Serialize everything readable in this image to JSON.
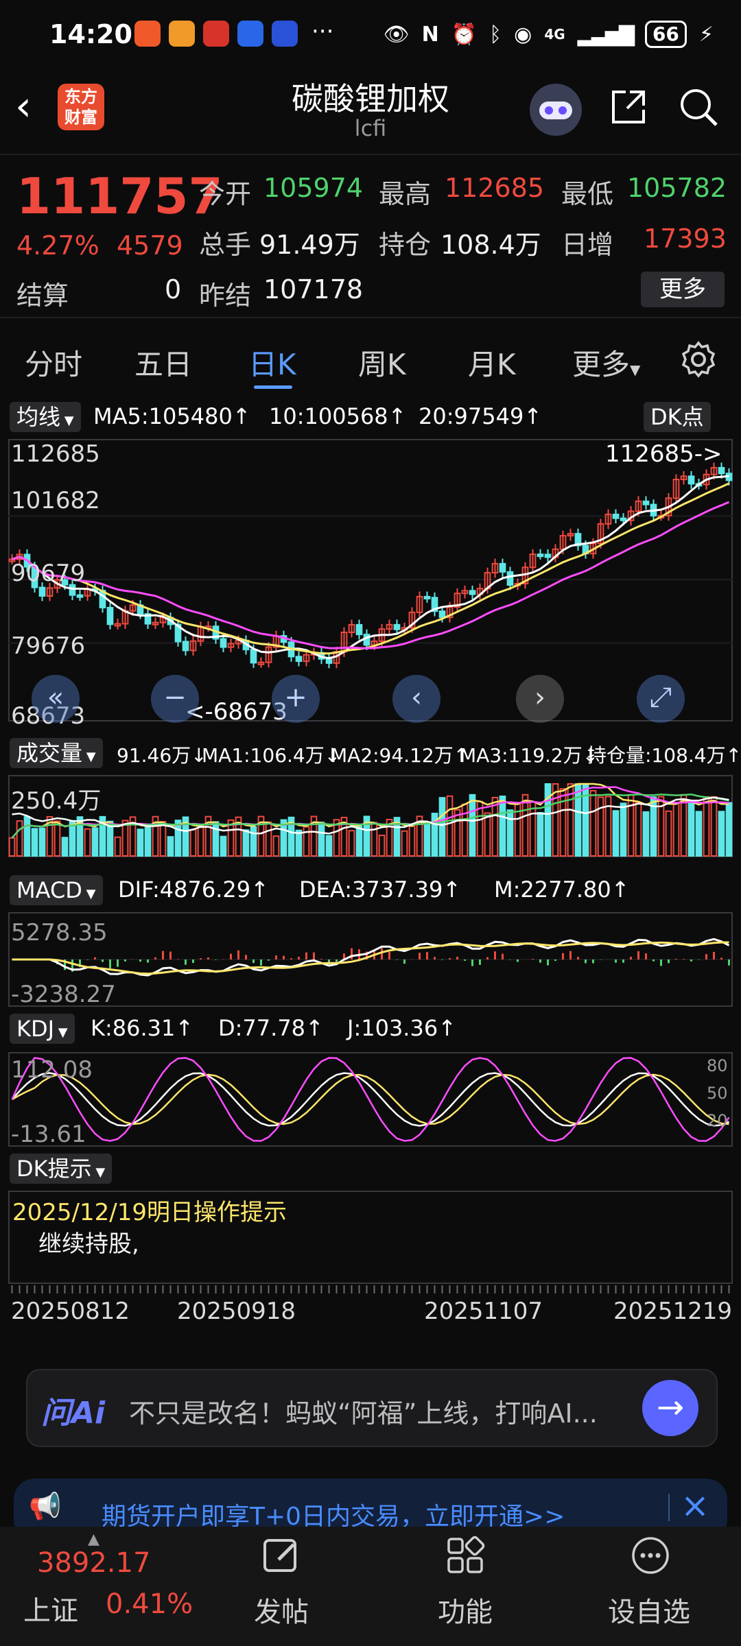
{
  "status": {
    "time": "14:20",
    "network": "4G",
    "battery": "66"
  },
  "header": {
    "title": "碳酸锂加权",
    "subtitle": "lcfi",
    "logo_line1": "东方",
    "logo_line2": "财富"
  },
  "quote": {
    "price": "111757",
    "change_pct": "4.27%",
    "change_abs": "4579",
    "open_label": "今开",
    "open": "105974",
    "high_label": "最高",
    "high": "112685",
    "low_label": "最低",
    "low": "105782",
    "volume_label": "总手",
    "volume": "91.49万",
    "oi_label": "持仓",
    "oi": "108.4万",
    "daily_inc_label": "日增",
    "daily_inc": "17393",
    "settle_label": "结算",
    "settle": "0",
    "prev_settle_label": "昨结",
    "prev_settle": "107178",
    "more": "更多"
  },
  "tabs": [
    "分时",
    "五日",
    "日K",
    "周K",
    "月K",
    "更多"
  ],
  "ma": {
    "toggle": "均线",
    "ma5": "MA5:105480↑",
    "ma10": "10:100568↑",
    "ma20": "20:97549↑",
    "dk": "DK点"
  },
  "price_axis": {
    "top": "112685",
    "l2": "101682",
    "l3": "90679",
    "l4": "79676",
    "bottom": "68673",
    "high_marker": "112685->",
    "low_marker": "<-68673"
  },
  "volume": {
    "label": "成交量",
    "vol": "91.46万↓",
    "ma1": "MA1:106.4万↓",
    "ma2": "MA2:94.12万↑",
    "ma3": "MA3:119.2万↓",
    "oi": "持仓量:108.4万↑",
    "axis": "250.4万"
  },
  "macd": {
    "label": "MACD",
    "dif": "DIF:4876.29↑",
    "dea": "DEA:3737.39↑",
    "m": "M:2277.80↑",
    "axis_top": "5278.35",
    "axis_bottom": "-3238.27"
  },
  "kdj": {
    "label": "KDJ",
    "k": "K:86.31↑",
    "d": "D:77.78↑",
    "j": "J:103.36↑",
    "axis_top": "112.08",
    "axis_bottom": "-13.61",
    "r80": "80",
    "r50": "50",
    "r20": "20"
  },
  "dk_tip": {
    "label": "DK提示",
    "title": "2025/12/19明日操作提示",
    "body": "继续持股,"
  },
  "dates": [
    "20250812",
    "20250918",
    "20251107",
    "20251219"
  ],
  "ai": {
    "brand": "问Ai",
    "text": "不只是改名！蚂蚁“阿福”上线，打响AI..."
  },
  "promo": {
    "text": "期货开户即享T+0日内交易，立即开通>>"
  },
  "bottom": {
    "index_value": "3892.17",
    "index_name": "上证",
    "index_change": "0.41%",
    "post": "发帖",
    "func": "功能",
    "watch": "设自选"
  },
  "colors": {
    "up": "#f04a3e",
    "down": "#4fd36b",
    "ma5": "#ffffff",
    "ma10": "#ffe66a",
    "ma20": "#ff4dff",
    "candle_down": "#5ee6e6"
  }
}
